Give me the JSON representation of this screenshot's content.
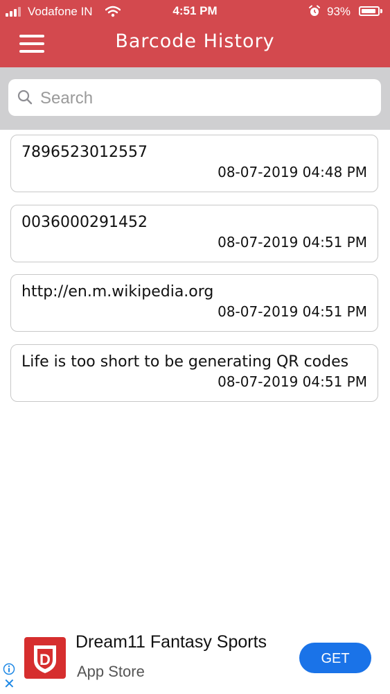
{
  "status_bar": {
    "carrier": "Vodafone IN",
    "time": "4:51 PM",
    "battery_percent": "93%",
    "battery_level": 0.93
  },
  "header": {
    "title": "Barcode History",
    "menu_icon": "hamburger-menu-icon",
    "background_color": "#d3494e"
  },
  "search": {
    "placeholder": "Search",
    "value": ""
  },
  "history": [
    {
      "content": "7896523012557",
      "datetime": "08-07-2019 04:48 PM"
    },
    {
      "content": "0036000291452",
      "datetime": "08-07-2019 04:51 PM"
    },
    {
      "content": "http://en.m.wikipedia.org",
      "datetime": "08-07-2019 04:51 PM"
    },
    {
      "content": "Life is too short to be generating QR codes",
      "datetime": "08-07-2019 04:51 PM"
    }
  ],
  "ad": {
    "title": "Dream11 Fantasy Sports",
    "subtitle": "App Store",
    "button_label": "GET",
    "logo_letter": "D",
    "close_glyph": "✕",
    "button_color": "#1a73e8"
  }
}
